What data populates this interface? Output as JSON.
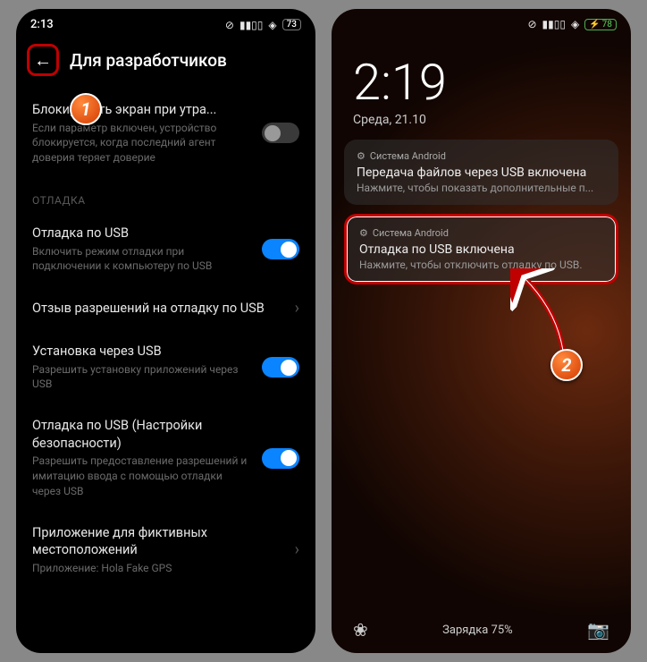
{
  "left": {
    "status": {
      "time": "2:13",
      "battery": "73"
    },
    "header": {
      "title": "Для разработчиков"
    },
    "item_lock": {
      "title": "Блокировать экран при утра...",
      "desc": "Если параметр включен, устройство блокируется, когда последний агент доверия теряет доверие"
    },
    "section_debug": "ОТЛАДКА",
    "item_usb_debug": {
      "title": "Отладка по USB",
      "desc": "Включить режим отладки при подключении к компьютеру по USB"
    },
    "item_revoke": {
      "title": "Отзыв разрешений на отладку по USB"
    },
    "item_install": {
      "title": "Установка через USB",
      "desc": "Разрешить установку приложений через USB"
    },
    "item_secure": {
      "title": "Отладка по USB (Настройки безопасности)",
      "desc": "Разрешить предоставление разрешений и имитацию ввода с помощью отладки через USB"
    },
    "item_mocklock": {
      "title": "Приложение для фиктивных местоположений",
      "desc": "Приложение: Hola Fake GPS"
    }
  },
  "right": {
    "status": {
      "battery": "78"
    },
    "clock": {
      "time": "2:19",
      "date": "Среда, 21.10"
    },
    "notif1": {
      "app": "Система Android",
      "title": "Передача файлов через USB включена",
      "body": "Нажмите, чтобы показать дополнительные п..."
    },
    "notif2": {
      "app": "Система Android",
      "title": "Отладка по USB включена",
      "body": "Нажмите, чтобы отключить отладку по USB."
    },
    "bottom": {
      "charging": "Зарядка 75%"
    }
  },
  "markers": {
    "m1": "1",
    "m2": "2"
  }
}
